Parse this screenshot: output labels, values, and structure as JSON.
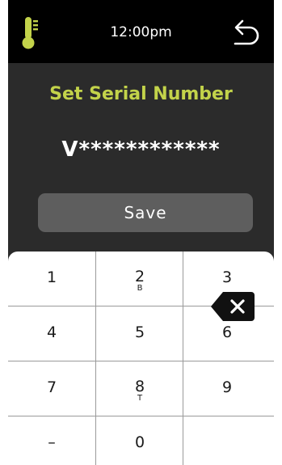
{
  "status_bar": {
    "time": "12:00pm",
    "left_icon": "thermometer-icon",
    "back_icon": "back-arrow-icon"
  },
  "screen": {
    "title": "Set Serial Number",
    "serial_value": "V************",
    "save_label": "Save"
  },
  "keypad": {
    "keys": [
      {
        "num": "1",
        "letter": ""
      },
      {
        "num": "2",
        "letter": "B"
      },
      {
        "num": "3",
        "letter": ""
      },
      {
        "num": "4",
        "letter": ""
      },
      {
        "num": "5",
        "letter": ""
      },
      {
        "num": "6",
        "letter": ""
      },
      {
        "num": "7",
        "letter": ""
      },
      {
        "num": "8",
        "letter": "T"
      },
      {
        "num": "9",
        "letter": ""
      },
      {
        "num": "–",
        "letter": ""
      },
      {
        "num": "0",
        "letter": ""
      }
    ],
    "backspace_icon": "backspace-icon"
  },
  "colors": {
    "accent": "#c3d34a",
    "background": "#2b2b2b",
    "status_bar": "#000000",
    "button": "#5e5e5e"
  }
}
